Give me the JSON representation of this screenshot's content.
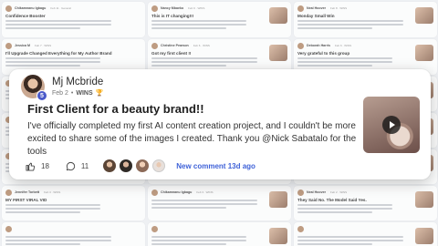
{
  "background_cards": [
    {
      "name": "Chikamnanu Igbagu",
      "meta": "Feb 11 · General",
      "title": "Confidence Booster"
    },
    {
      "name": "Nancy Mbaeko",
      "meta": "Feb 9 · WINS",
      "title": "This is IT changing!!!"
    },
    {
      "name": "Neal Hoover",
      "meta": "Feb 8 · WINS",
      "title": "Monday Small Win"
    },
    {
      "name": "Jessica M",
      "meta": "Feb 7 · WINS",
      "title": "I'll Upgrade Changed Everything for My Author Brand"
    },
    {
      "name": "Christine Pearson",
      "meta": "Feb 6 · WINS",
      "title": "Got my first client !!"
    },
    {
      "name": "Deborah Harris",
      "meta": "Feb 6 · WINS",
      "title": "Very grateful to this group"
    },
    {
      "name": "",
      "meta": "",
      "title": ""
    },
    {
      "name": "",
      "meta": "",
      "title": ""
    },
    {
      "name": "",
      "meta": "",
      "title": ""
    },
    {
      "name": "",
      "meta": "",
      "title": ""
    },
    {
      "name": "",
      "meta": "",
      "title": ""
    },
    {
      "name": "",
      "meta": "",
      "title": ""
    },
    {
      "name": "",
      "meta": "",
      "title": ""
    },
    {
      "name": "",
      "meta": "",
      "title": ""
    },
    {
      "name": "",
      "meta": "",
      "title": ""
    },
    {
      "name": "Jennifer Torbett",
      "meta": "Feb 3 · WINS",
      "title": "MY FIRST VIRAL VID"
    },
    {
      "name": "Chikamnanu Igbagu",
      "meta": "Feb 3 · WINS",
      "title": ""
    },
    {
      "name": "Neal Hoover",
      "meta": "Feb 2 · WINS",
      "title": "They Said No. The Model Said Yes."
    },
    {
      "name": "",
      "meta": "",
      "title": ""
    },
    {
      "name": "",
      "meta": "",
      "title": ""
    },
    {
      "name": "",
      "meta": "",
      "title": ""
    }
  ],
  "post": {
    "author": "Mj Mcbride",
    "level": "5",
    "date": "Feb 2",
    "category": "WINS",
    "trophy_icon": "trophy-icon",
    "title": "First Client for a beauty brand!!",
    "body": "I've officially completed my first AI content creation project, and I couldn't be more excited to share some of the images I created. Thank you @Nick Sabatalo for the tools",
    "likes": "18",
    "comments": "11",
    "new_comment_label": "New comment",
    "new_comment_time": "13d ago",
    "colors": {
      "accent": "#3f62d8",
      "badge": "#4a59c9"
    }
  }
}
